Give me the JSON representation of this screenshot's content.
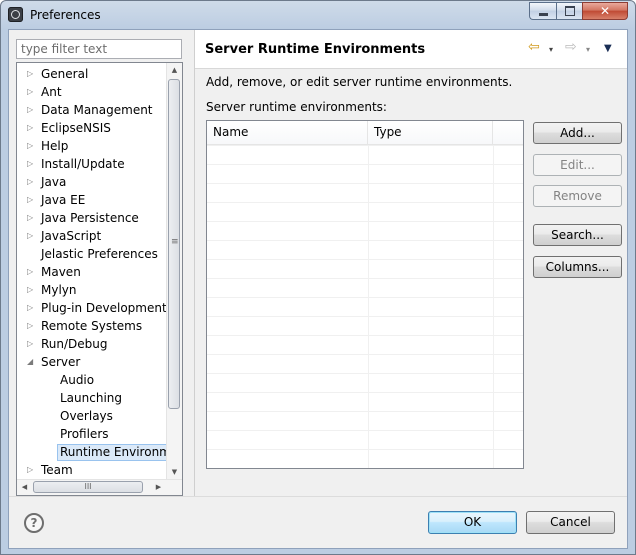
{
  "window": {
    "title": "Preferences",
    "icon": "eclipse-preferences-icon"
  },
  "filter": {
    "placeholder": "type filter text",
    "value": ""
  },
  "tree": {
    "items": [
      {
        "label": "General",
        "expandable": true,
        "level": 0
      },
      {
        "label": "Ant",
        "expandable": true,
        "level": 0
      },
      {
        "label": "Data Management",
        "expandable": true,
        "level": 0
      },
      {
        "label": "EclipseNSIS",
        "expandable": true,
        "level": 0
      },
      {
        "label": "Help",
        "expandable": true,
        "level": 0
      },
      {
        "label": "Install/Update",
        "expandable": true,
        "level": 0
      },
      {
        "label": "Java",
        "expandable": true,
        "level": 0
      },
      {
        "label": "Java EE",
        "expandable": true,
        "level": 0
      },
      {
        "label": "Java Persistence",
        "expandable": true,
        "level": 0
      },
      {
        "label": "JavaScript",
        "expandable": true,
        "level": 0
      },
      {
        "label": "Jelastic Preferences",
        "expandable": false,
        "level": 0
      },
      {
        "label": "Maven",
        "expandable": true,
        "level": 0
      },
      {
        "label": "Mylyn",
        "expandable": true,
        "level": 0
      },
      {
        "label": "Plug-in Development",
        "expandable": true,
        "level": 0
      },
      {
        "label": "Remote Systems",
        "expandable": true,
        "level": 0
      },
      {
        "label": "Run/Debug",
        "expandable": true,
        "level": 0
      },
      {
        "label": "Server",
        "expandable": true,
        "expanded": true,
        "level": 0
      },
      {
        "label": "Audio",
        "expandable": false,
        "level": 1
      },
      {
        "label": "Launching",
        "expandable": false,
        "level": 1
      },
      {
        "label": "Overlays",
        "expandable": false,
        "level": 1
      },
      {
        "label": "Profilers",
        "expandable": false,
        "level": 1
      },
      {
        "label": "Runtime Environme",
        "expandable": false,
        "level": 1,
        "selected": true
      },
      {
        "label": "Team",
        "expandable": true,
        "level": 0
      }
    ],
    "hscroll_grip": "III"
  },
  "page": {
    "title": "Server Runtime Environments",
    "description": "Add, remove, or edit server runtime environments.",
    "table_label": "Server runtime environments:",
    "columns": [
      "Name",
      "Type",
      ""
    ],
    "rows": [],
    "buttons": {
      "add": "Add...",
      "edit": "Edit...",
      "remove": "Remove",
      "search": "Search...",
      "columns": "Columns..."
    }
  },
  "nav": {
    "back": "⇦",
    "forward": "⇨",
    "dropdown": "▾",
    "menu": "▼"
  },
  "dialog": {
    "help": "?",
    "ok": "OK",
    "cancel": "Cancel"
  },
  "colors": {
    "accent": "#3c7fb1",
    "selection": "#dbe9f8",
    "back_arrow": "#d19a1c"
  }
}
